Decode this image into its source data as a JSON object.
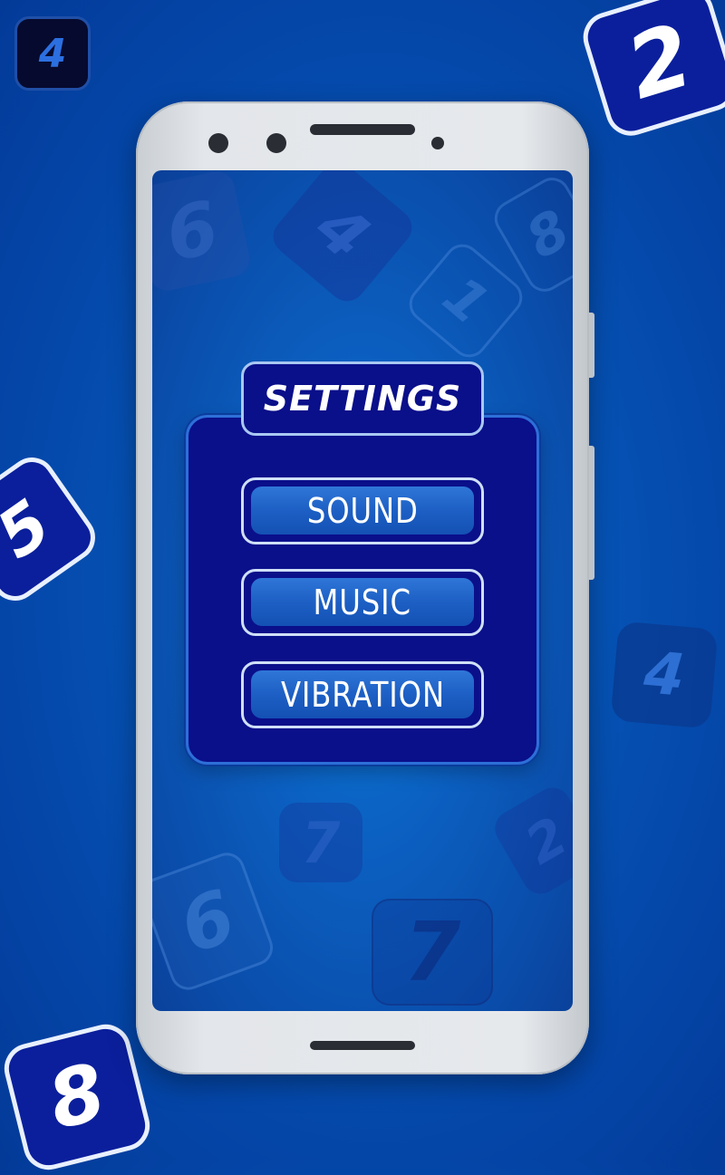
{
  "background_tiles": [
    {
      "id": "tile-top-left",
      "text": "4"
    },
    {
      "id": "tile-top-right",
      "text": "2"
    },
    {
      "id": "tile-left",
      "text": "5"
    },
    {
      "id": "tile-bottom-left",
      "text": "8"
    },
    {
      "id": "tile-right",
      "text": "4"
    }
  ],
  "screen_tiles": [
    "6",
    "4",
    "8",
    "1",
    "7",
    "2",
    "6",
    "7"
  ],
  "settings": {
    "title": "SETTINGS",
    "options": [
      {
        "label": "SOUND"
      },
      {
        "label": "MUSIC"
      },
      {
        "label": "VIBRATION"
      }
    ]
  },
  "colors": {
    "background": "#0656b8",
    "panel": "#0a0f8a",
    "button_fill": "#1d5fc4",
    "button_border": "#cfe0f8",
    "phone_frame": "#e3e6ea"
  }
}
